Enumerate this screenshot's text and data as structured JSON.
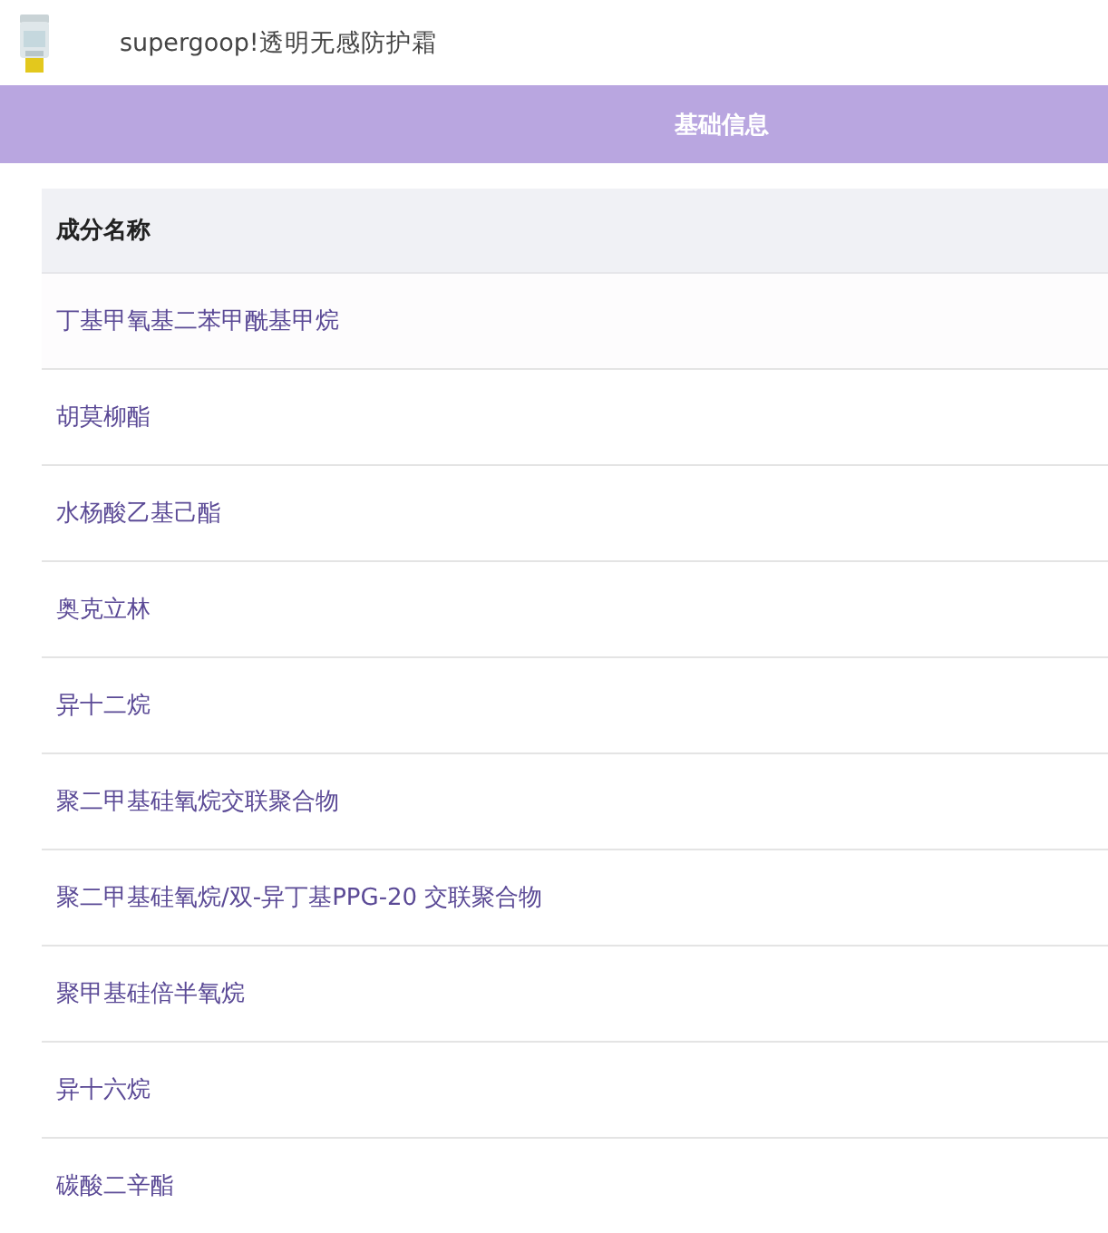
{
  "product": {
    "title": "supergoop!透明无感防护霜"
  },
  "section_bar": {
    "title": "基础信息"
  },
  "table": {
    "columns": [
      "成分名称"
    ],
    "rows": [
      "丁基甲氧基二苯甲酰基甲烷",
      "胡莫柳酯",
      "水杨酸乙基己酯",
      "奥克立林",
      "异十二烷",
      "聚二甲基硅氧烷交联聚合物",
      "聚二甲基硅氧烷/双-异丁基PPG-20 交联聚合物",
      "聚甲基硅倍半氧烷",
      "异十六烷",
      "碳酸二辛酯"
    ]
  }
}
